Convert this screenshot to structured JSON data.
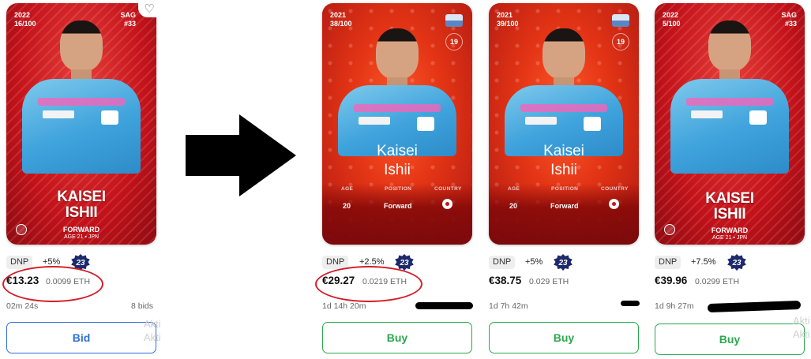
{
  "cards": [
    {
      "style": "2022",
      "year": "2022",
      "serial": "16/100",
      "club": "SAG",
      "club_no": "#33",
      "name_line1": "KAISEI",
      "name_line2": "ISHII",
      "position": "FORWARD",
      "age_line": "AGE 21",
      "country": "JPN",
      "favorite_icon": "♡",
      "status": "DNP",
      "bonus": "+5%",
      "score": "23",
      "price_eur": "€13.23",
      "price_eth": "0.0099 ETH",
      "time_left": "02m 24s",
      "bids": "8 bids",
      "action": "Bid"
    },
    {
      "style": "2021",
      "year": "2021",
      "serial": "38/100",
      "shirt_no": "19",
      "name_line1": "Kaisei",
      "name_line2": "Ishii",
      "age_label": "AGE",
      "age_value": "20",
      "position_label": "POSITION",
      "position_value": "Forward",
      "country_label": "COUNTRY",
      "status": "DNP",
      "bonus": "+2.5%",
      "score": "23",
      "price_eur": "€29.27",
      "price_eth": "0.0219 ETH",
      "time_left": "1d 14h 20m",
      "action": "Buy"
    },
    {
      "style": "2021",
      "year": "2021",
      "serial": "39/100",
      "shirt_no": "19",
      "name_line1": "Kaisei",
      "name_line2": "Ishii",
      "age_label": "AGE",
      "age_value": "20",
      "position_label": "POSITION",
      "position_value": "Forward",
      "country_label": "COUNTRY",
      "status": "DNP",
      "bonus": "+5%",
      "score": "23",
      "price_eur": "€38.75",
      "price_eth": "0.029 ETH",
      "time_left": "1d 7h 42m",
      "action": "Buy"
    },
    {
      "style": "2022",
      "year": "2022",
      "serial": "5/100",
      "club": "SAG",
      "club_no": "#33",
      "name_line1": "KAISEI",
      "name_line2": "ISHII",
      "position": "FORWARD",
      "age_line": "AGE 21",
      "country": "JPN",
      "status": "DNP",
      "bonus": "+7.5%",
      "score": "23",
      "price_eur": "€39.96",
      "price_eth": "0.0299 ETH",
      "time_left": "1d 9h 27m",
      "action": "Buy"
    }
  ],
  "watermark": {
    "line1": "Akti",
    "line2": "Akti"
  },
  "colors": {
    "annotation": "#d31d28",
    "buy": "#2ca84e",
    "bid": "#2f6fd6",
    "score_badge": "#1c2a6b"
  }
}
